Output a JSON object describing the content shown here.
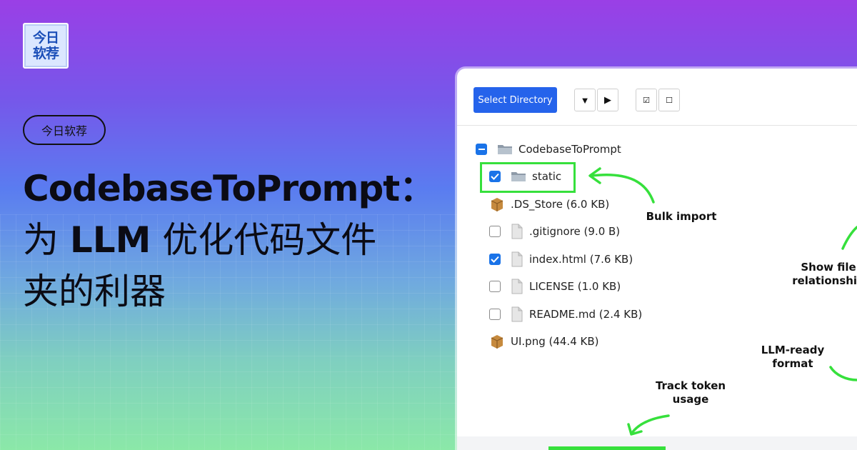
{
  "logo": {
    "line1": "今日",
    "line2": "软荐"
  },
  "badge": "今日软荐",
  "headline": {
    "line1": "CodebaseToPrompt：",
    "line2_prefix": "为 ",
    "line2_bold": "LLM",
    "line2_suffix": " 优化代码文件",
    "line3": "夹的利器"
  },
  "toolbar": {
    "select_directory": "Select Directory",
    "collapse_all": "▼",
    "expand_all": "▶",
    "select_all": "☑",
    "deselect_all": "☐"
  },
  "tree": {
    "root": {
      "name": "CodebaseToPrompt",
      "state": "indeterminate"
    },
    "items": [
      {
        "name": "static",
        "type": "folder",
        "checked": true
      },
      {
        "name": ".DS_Store (6.0 KB)",
        "type": "package",
        "checked": null
      },
      {
        "name": ".gitignore (9.0 B)",
        "type": "file",
        "checked": false
      },
      {
        "name": "index.html (7.6 KB)",
        "type": "file",
        "checked": true
      },
      {
        "name": "LICENSE (1.0 KB)",
        "type": "file",
        "checked": false
      },
      {
        "name": "README.md (2.4 KB)",
        "type": "file",
        "checked": false
      },
      {
        "name": "UI.png (44.4 KB)",
        "type": "package",
        "checked": null
      }
    ]
  },
  "annotations": {
    "bulk_import": "Bulk import",
    "show_file_1": "Show file",
    "show_file_2": "relationship",
    "llm_ready_1": "LLM-ready",
    "llm_ready_2": "format",
    "track_token_1": "Track token",
    "track_token_2": "usage"
  },
  "colors": {
    "accent": "#2563eb",
    "checkbox": "#1a73e8",
    "highlight": "#36e03c"
  }
}
